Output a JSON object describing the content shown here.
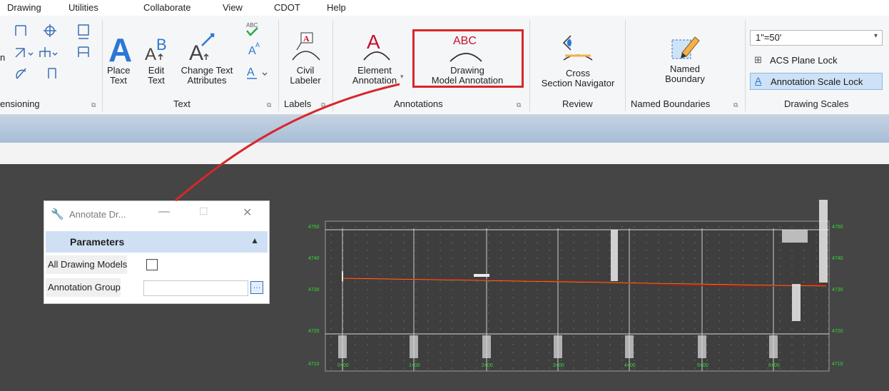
{
  "menu": [
    "Drawing",
    "Utilities",
    "Collaborate",
    "View",
    "CDOT",
    "Help"
  ],
  "ribbon": {
    "dimensioning_label": "ensioning",
    "dim_fragment": "n",
    "text_group": {
      "label": "Text",
      "place_text": [
        "Place",
        "Text"
      ],
      "edit_text": [
        "Edit",
        "Text"
      ],
      "change_text": [
        "Change Text",
        "Attributes"
      ]
    },
    "labels_group": {
      "label": "Labels",
      "civil_labeler": [
        "Civil",
        "Labeler"
      ]
    },
    "annotations_group": {
      "label": "Annotations",
      "element_annotation": [
        "Element",
        "Annotation"
      ],
      "drawing_model_annotation": [
        "Drawing",
        "Model Annotation"
      ],
      "abc_icon_text": "ABC"
    },
    "review_group": {
      "label": "Review",
      "cross_section": [
        "Cross",
        "Section Navigator"
      ]
    },
    "named_boundaries_group": {
      "label": "Named Boundaries",
      "named_boundary": [
        "Named",
        "Boundary"
      ]
    },
    "drawing_scales_group": {
      "label": "Drawing Scales",
      "scale_value": "1\"=50'",
      "acs_plane_lock": "ACS Plane Lock",
      "annotation_scale_lock": "Annotation Scale Lock"
    }
  },
  "dialog": {
    "title": "Annotate Dr...",
    "section": "Parameters",
    "all_drawing_models_label": "All Drawing Models",
    "all_drawing_models_checked": false,
    "annotation_group_label": "Annotation Group",
    "annotation_group_value": ""
  },
  "plot": {
    "y_labels_left": [
      "4750",
      "4740",
      "4730",
      "4720",
      "4710"
    ],
    "y_labels_right": [
      "4750",
      "4740",
      "4730",
      "4720",
      "4710"
    ],
    "x_labels": [
      "0+00",
      "1+00",
      "2+00",
      "3+00",
      "4+00",
      "5+00",
      "6+00"
    ]
  },
  "colors": {
    "highlight_box": "#d8262c",
    "profile_line": "#b01818",
    "plot_label_green": "#33dd33",
    "dialog_header": "#cfe0f5",
    "annotation_red": "#c8102e"
  }
}
